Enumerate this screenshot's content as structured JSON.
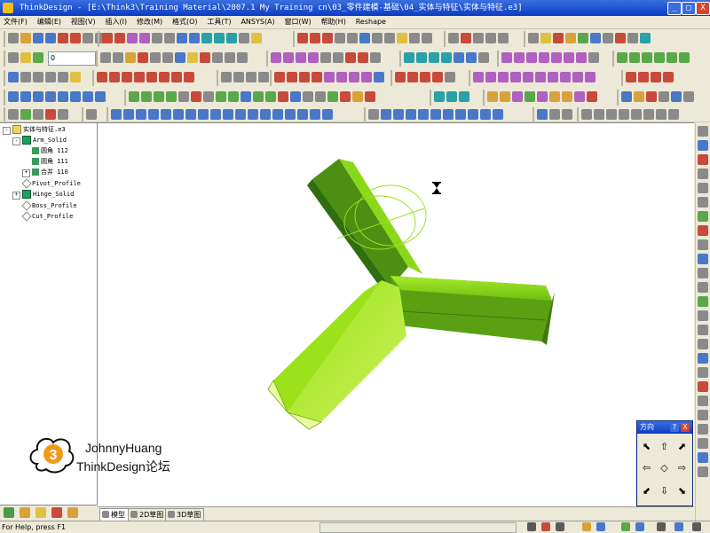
{
  "window": {
    "title": "ThinkDesign - [E:\\Think3\\Training Material\\2007.1 My Training cn\\03_零件建模-基础\\04_实体与特征\\实体与特征.e3]",
    "buttons": [
      "_",
      "□",
      "X"
    ]
  },
  "menu": [
    "文件(F)",
    "编辑(E)",
    "视图(V)",
    "插入(I)",
    "修改(M)",
    "格式(O)",
    "工具(T)",
    "ANSYS(A)",
    "窗口(W)",
    "帮助(H)",
    "Reshape"
  ],
  "toolbar": {
    "layer_value": "0"
  },
  "tree": {
    "root": "实体与特征.e3",
    "items": [
      {
        "label": "Arm_Solid"
      },
      {
        "label": "圆角 112"
      },
      {
        "label": "圆角 111"
      },
      {
        "label": "合并 110"
      },
      {
        "label": "Pivot_Profile"
      },
      {
        "label": "Hinge_Solid"
      },
      {
        "label": "Boss_Profile"
      },
      {
        "label": "Cut_Profile"
      }
    ]
  },
  "view_tabs": [
    "模型",
    "2D草图",
    "3D草图"
  ],
  "direction_panel": {
    "title": "方向",
    "help": "?",
    "close": "X"
  },
  "watermark": {
    "badge": "3",
    "line1": "JohnnyHuang",
    "line2": "ThinkDesign论坛"
  },
  "status": {
    "text": "For Help, press F1"
  },
  "colors": {
    "arm_light": "#9be21a",
    "arm_dark": "#2f6d0e",
    "arm_pale": "#eaffa0",
    "titlebar": "#0a3cc4"
  }
}
